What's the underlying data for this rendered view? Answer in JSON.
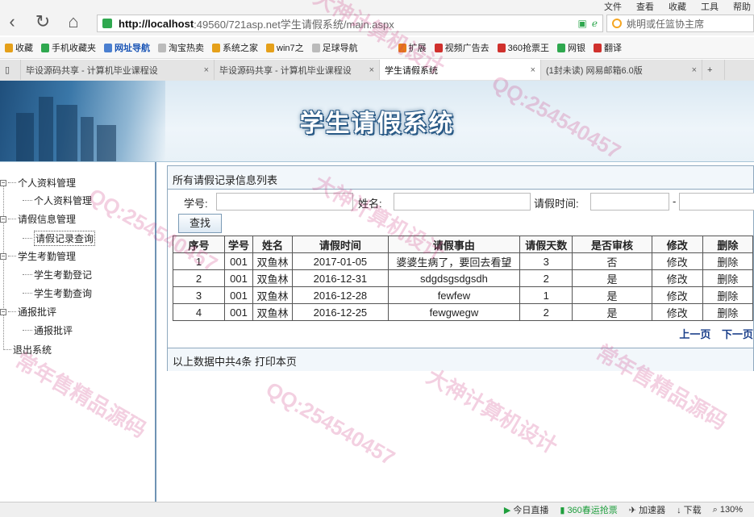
{
  "browser": {
    "menu": [
      "文件",
      "查看",
      "收藏",
      "工具",
      "帮助"
    ],
    "url_host": "http://localhost",
    "url_rest": ":49560/721asp.net学生请假系统/main.aspx",
    "search_placeholder": "姚明或任篮协主席",
    "bookmarks": [
      "收藏",
      "手机收藏夹",
      "网址导航",
      "淘宝热卖",
      "系统之家",
      "win7之",
      "足球导航",
      "扩展",
      "视频广告去",
      "360抢票王",
      "网银",
      "翻译"
    ],
    "tabs": [
      {
        "label": "毕设源码共享 - 计算机毕业课程设"
      },
      {
        "label": "毕设源码共享 - 计算机毕业课程设"
      },
      {
        "label": "学生请假系统"
      },
      {
        "label": "(1封未读) 网易邮箱6.0版"
      }
    ],
    "status": [
      "今日直播",
      "360春运抢票",
      "加速器",
      "下载",
      "130%"
    ]
  },
  "header": {
    "system_name": "学生请假系统"
  },
  "sidebar": {
    "groups": [
      {
        "label": "个人资料管理",
        "items": [
          "个人资料管理"
        ]
      },
      {
        "label": "请假信息管理",
        "items": [
          "请假记录查询"
        ]
      },
      {
        "label": "学生考勤管理",
        "items": [
          "学生考勤登记",
          "学生考勤查询"
        ]
      },
      {
        "label": "通报批评",
        "items": [
          "通报批评"
        ]
      },
      {
        "label": "退出系统",
        "items": []
      }
    ]
  },
  "main": {
    "title": "所有请假记录信息列表",
    "filters": {
      "student_id_label": "学号:",
      "name_label": "姓名:",
      "leave_time_label": "请假时间:",
      "range_sep": "-",
      "search_button": "查找"
    },
    "table": {
      "headers": [
        "序号",
        "学号",
        "姓名",
        "请假时间",
        "请假事由",
        "请假天数",
        "是否审核",
        "修改",
        "删除"
      ],
      "rows": [
        [
          "1",
          "001",
          "双鱼林",
          "2017-01-05",
          "婆婆生病了，要回去看望",
          "3",
          "否",
          "修改",
          "删除"
        ],
        [
          "2",
          "001",
          "双鱼林",
          "2016-12-31",
          "sdgdsgsdgsdh",
          "2",
          "是",
          "修改",
          "删除"
        ],
        [
          "3",
          "001",
          "双鱼林",
          "2016-12-28",
          "fewfew",
          "1",
          "是",
          "修改",
          "删除"
        ],
        [
          "4",
          "001",
          "双鱼林",
          "2016-12-25",
          "fewgwegw",
          "2",
          "是",
          "修改",
          "删除"
        ]
      ]
    },
    "pager": {
      "prev": "上一页",
      "next": "下一页"
    },
    "footer": {
      "summary": "以上数据中共4条",
      "print": "打印本页"
    }
  },
  "watermarks": [
    "QQ:254540457",
    "大神计算机设计",
    "常年售精品源码"
  ]
}
